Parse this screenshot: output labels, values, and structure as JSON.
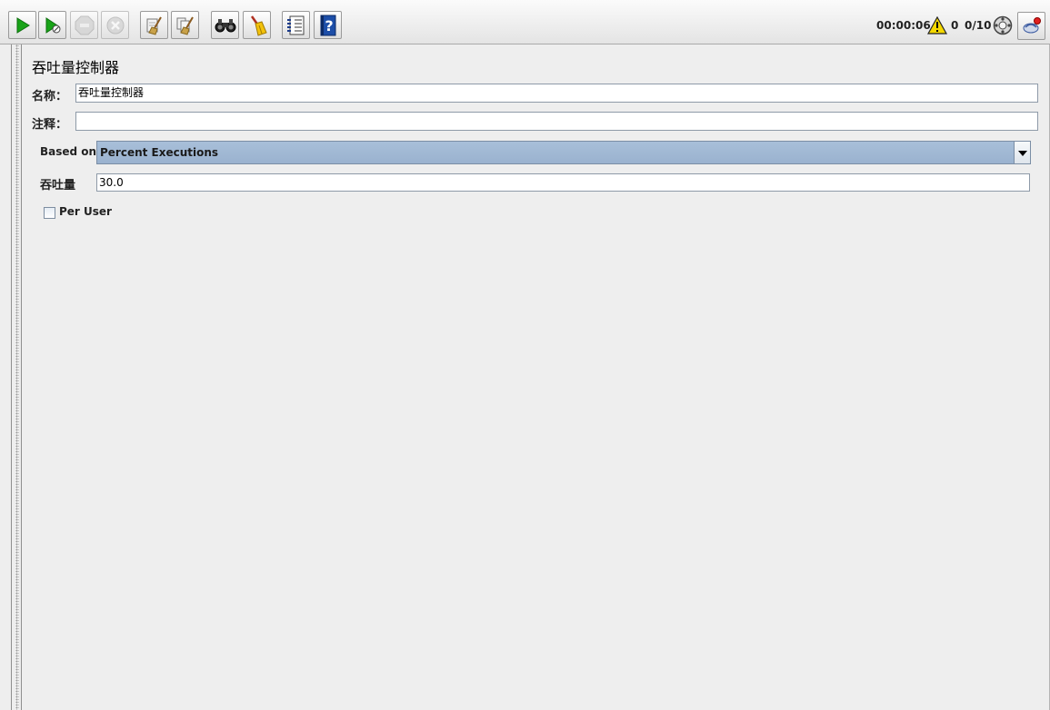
{
  "toolbar": {
    "buttons": [
      {
        "name": "start-icon"
      },
      {
        "name": "start-no-pauses-icon"
      },
      {
        "name": "stop-icon"
      },
      {
        "name": "shutdown-icon"
      },
      {
        "name": "clear-icon"
      },
      {
        "name": "clear-all-icon"
      },
      {
        "name": "search-icon"
      },
      {
        "name": "reset-search-icon"
      },
      {
        "name": "function-helper-icon"
      },
      {
        "name": "help-icon"
      }
    ],
    "elapsed_time": "00:00:06",
    "error_count": "0",
    "threads": "0/10"
  },
  "panel": {
    "title": "吞吐量控制器",
    "name_label": "名称：",
    "name_value": "吞吐量控制器",
    "comment_label": "注释：",
    "comment_value": "",
    "based_on_label": "Based on",
    "based_on_value": "Percent Executions",
    "throughput_label": "吞吐量",
    "throughput_value": "30.0",
    "per_user_label": "Per User",
    "per_user_checked": false
  },
  "colors": {
    "combo_selection": "#a8bfd9",
    "warning": "#f5d800",
    "start_green": "#1aa31a"
  }
}
